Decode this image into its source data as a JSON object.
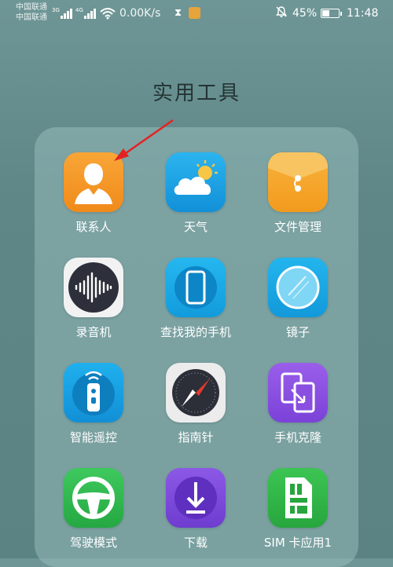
{
  "status_bar": {
    "carrier_1": "中国联通",
    "carrier_2": "中国联通",
    "sig1_tag": "3G",
    "sig2_tag": "4G",
    "net_speed": "0.00K/s",
    "battery_percent": "45%",
    "battery_level": 0.45,
    "time": "11:48"
  },
  "folder": {
    "title": "实用工具",
    "apps": [
      {
        "label": "联系人",
        "icon": "contacts-icon",
        "color": "#f39a1e"
      },
      {
        "label": "天气",
        "icon": "weather-icon",
        "color": "#1a9fe0"
      },
      {
        "label": "文件管理",
        "icon": "file-manager-icon",
        "color": "#f5a623"
      },
      {
        "label": "录音机",
        "icon": "recorder-icon",
        "color": "#2c2f3a"
      },
      {
        "label": "查找我的手机",
        "icon": "find-phone-icon",
        "color": "#1aa8e6"
      },
      {
        "label": "镜子",
        "icon": "mirror-icon",
        "color": "#1aa5e0"
      },
      {
        "label": "智能遥控",
        "icon": "remote-icon",
        "color": "#1a9fe0"
      },
      {
        "label": "指南针",
        "icon": "compass-icon",
        "color": "#e8e8e8"
      },
      {
        "label": "手机克隆",
        "icon": "phone-clone-icon",
        "color": "#8a4fe0"
      },
      {
        "label": "驾驶模式",
        "icon": "driving-mode-icon",
        "color": "#2db84d"
      },
      {
        "label": "下载",
        "icon": "download-icon",
        "color": "#7c47d8"
      },
      {
        "label": "SIM 卡应用1",
        "icon": "sim-card-icon",
        "color": "#2fb446"
      }
    ]
  },
  "annotation": {
    "arrow_color": "#e52222"
  }
}
